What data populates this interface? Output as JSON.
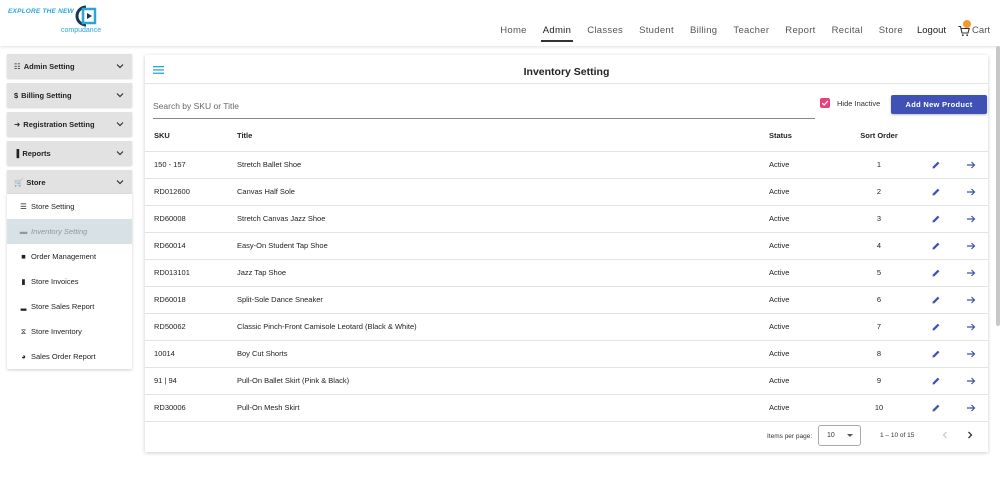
{
  "logo": {
    "tagline": "EXPLORE THE NEW",
    "subtext": "compudance"
  },
  "nav": {
    "items": [
      "Home",
      "Admin",
      "Classes",
      "Student",
      "Billing",
      "Teacher",
      "Report",
      "Recital",
      "Store"
    ],
    "active": "Admin",
    "logout": "Logout",
    "cart": "Cart"
  },
  "sidebar": {
    "groups": [
      {
        "icon": "list-icon",
        "glyph": "☷",
        "label": "Admin Setting"
      },
      {
        "icon": "dollar-icon",
        "glyph": "$",
        "label": "Billing Setting"
      },
      {
        "icon": "sign-in-icon",
        "glyph": "➜",
        "label": "Registration Setting"
      },
      {
        "icon": "bar-chart-icon",
        "glyph": "▐",
        "label": "Reports"
      },
      {
        "icon": "cart-icon",
        "glyph": "🛒",
        "label": "Store"
      }
    ],
    "store_items": [
      {
        "icon": "list-icon",
        "glyph": "☰",
        "label": "Store Setting"
      },
      {
        "icon": "warehouse-icon",
        "glyph": "▬",
        "label": "Inventory Setting",
        "active": true
      },
      {
        "icon": "bag-icon",
        "glyph": "■",
        "label": "Order Management"
      },
      {
        "icon": "invoice-icon",
        "glyph": "▮",
        "label": "Store Invoices"
      },
      {
        "icon": "signal-icon",
        "glyph": "▂",
        "label": "Store Sales Report"
      },
      {
        "icon": "hourglass-icon",
        "glyph": "⧖",
        "label": "Store Inventory"
      },
      {
        "icon": "pie-chart-icon",
        "glyph": "◕",
        "label": "Sales Order Report"
      }
    ]
  },
  "main": {
    "title": "Inventory Setting",
    "search_placeholder": "Search by SKU or Title",
    "hide_inactive_label": "Hide Inactive",
    "hide_inactive_checked": true,
    "add_button": "Add New Product",
    "columns": {
      "sku": "SKU",
      "title": "Title",
      "status": "Status",
      "sort": "Sort Order"
    },
    "rows": [
      {
        "sku": "150 - 157",
        "title": "Stretch Ballet Shoe",
        "status": "Active",
        "sort": "1"
      },
      {
        "sku": "RD012600",
        "title": "Canvas Half Sole",
        "status": "Active",
        "sort": "2"
      },
      {
        "sku": "RD60008",
        "title": "Stretch Canvas Jazz Shoe",
        "status": "Active",
        "sort": "3"
      },
      {
        "sku": "RD60014",
        "title": "Easy-On Student Tap Shoe",
        "status": "Active",
        "sort": "4"
      },
      {
        "sku": "RD013101",
        "title": "Jazz Tap Shoe",
        "status": "Active",
        "sort": "5"
      },
      {
        "sku": "RD60018",
        "title": "Split-Sole Dance Sneaker",
        "status": "Active",
        "sort": "6"
      },
      {
        "sku": "RD50062",
        "title": "Classic Pinch-Front Camisole Leotard (Black & White)",
        "status": "Active",
        "sort": "7"
      },
      {
        "sku": "10014",
        "title": "Boy Cut Shorts",
        "status": "Active",
        "sort": "8"
      },
      {
        "sku": "91 | 94",
        "title": "Pull-On Ballet Skirt (Pink & Black)",
        "status": "Active",
        "sort": "9"
      },
      {
        "sku": "RD30006",
        "title": "Pull-On Mesh Skirt",
        "status": "Active",
        "sort": "10"
      }
    ],
    "paginator": {
      "label": "Items per page:",
      "page_size": "10",
      "range": "1 – 10 of 15"
    }
  },
  "colors": {
    "primary": "#3f51b5",
    "checkbox": "#e8417a",
    "brand": "#2aa7d6",
    "cart_badge": "#f29a2e"
  }
}
